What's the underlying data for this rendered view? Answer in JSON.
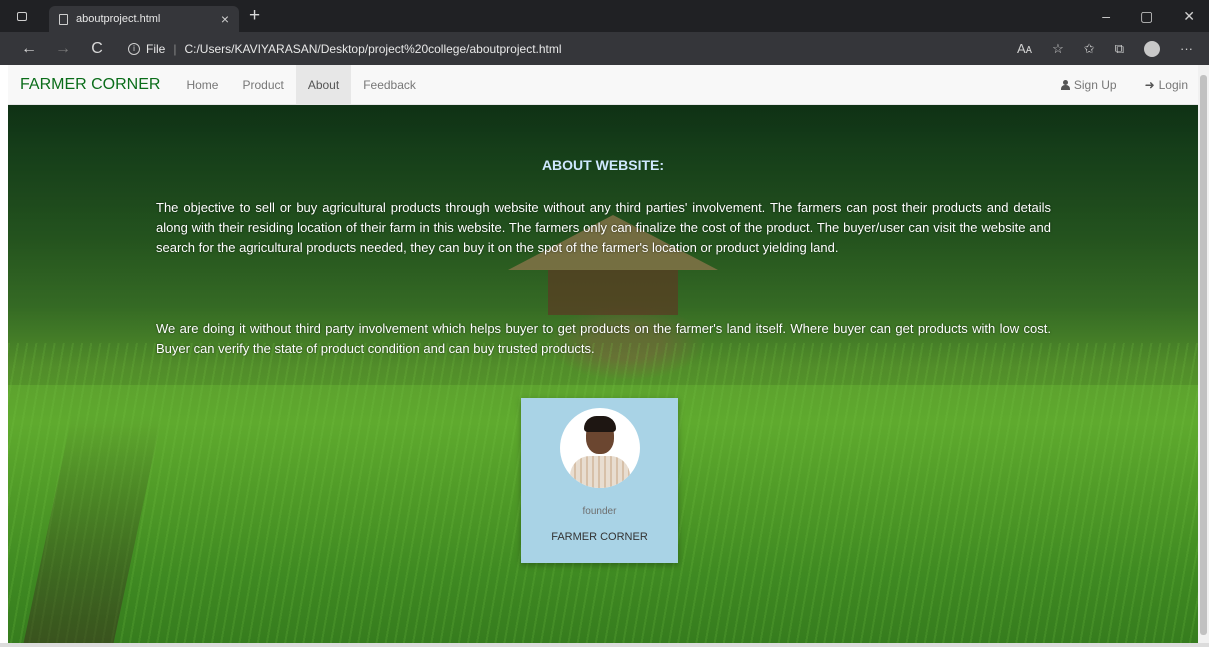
{
  "browser": {
    "tab_title": "aboutproject.html",
    "tab_close": "×",
    "new_tab": "+",
    "window_controls": {
      "minimize": "–",
      "restore": "▢",
      "close": "✕"
    },
    "nav": {
      "back": "←",
      "forward": "→",
      "refresh": "C"
    },
    "file_label": "File",
    "url_separator": "|",
    "url": "C:/Users/KAVIYARASAN/Desktop/project%20college/aboutproject.html",
    "toolbar_icons": {
      "read_aloud": "Aᴀ",
      "add_favorite": "☆",
      "favorites": "✩",
      "collections": "⧉",
      "more": "···"
    }
  },
  "navbar": {
    "brand": "FARMER CORNER",
    "links": [
      {
        "label": "Home",
        "active": false
      },
      {
        "label": "Product",
        "active": false
      },
      {
        "label": "About",
        "active": true
      },
      {
        "label": "Feedback",
        "active": false
      }
    ],
    "signup": "Sign Up",
    "login": "Login",
    "login_icon": "➜"
  },
  "main": {
    "title": "ABOUT WEBSITE:",
    "paragraph1": "The objective to sell or buy agricultural products through website without any third parties' involvement. The farmers can post their products and details along with their residing location of their farm in this website. The farmers only can finalize the cost of the product. The buyer/user can visit the website and search for the agricultural products needed, they can buy it on the spot of the farmer's location or product yielding land.",
    "paragraph2": "We are doing it without third party involvement which helps buyer to get products on the farmer's land itself. Where buyer can get products with low cost. Buyer can verify the state of product condition and can buy trusted products."
  },
  "founder_card": {
    "role": "founder",
    "organization": "FARMER CORNER",
    "background_color": "#a9d3e6"
  },
  "colors": {
    "brand": "#0b6d1a",
    "title": "#cfe8ff"
  }
}
